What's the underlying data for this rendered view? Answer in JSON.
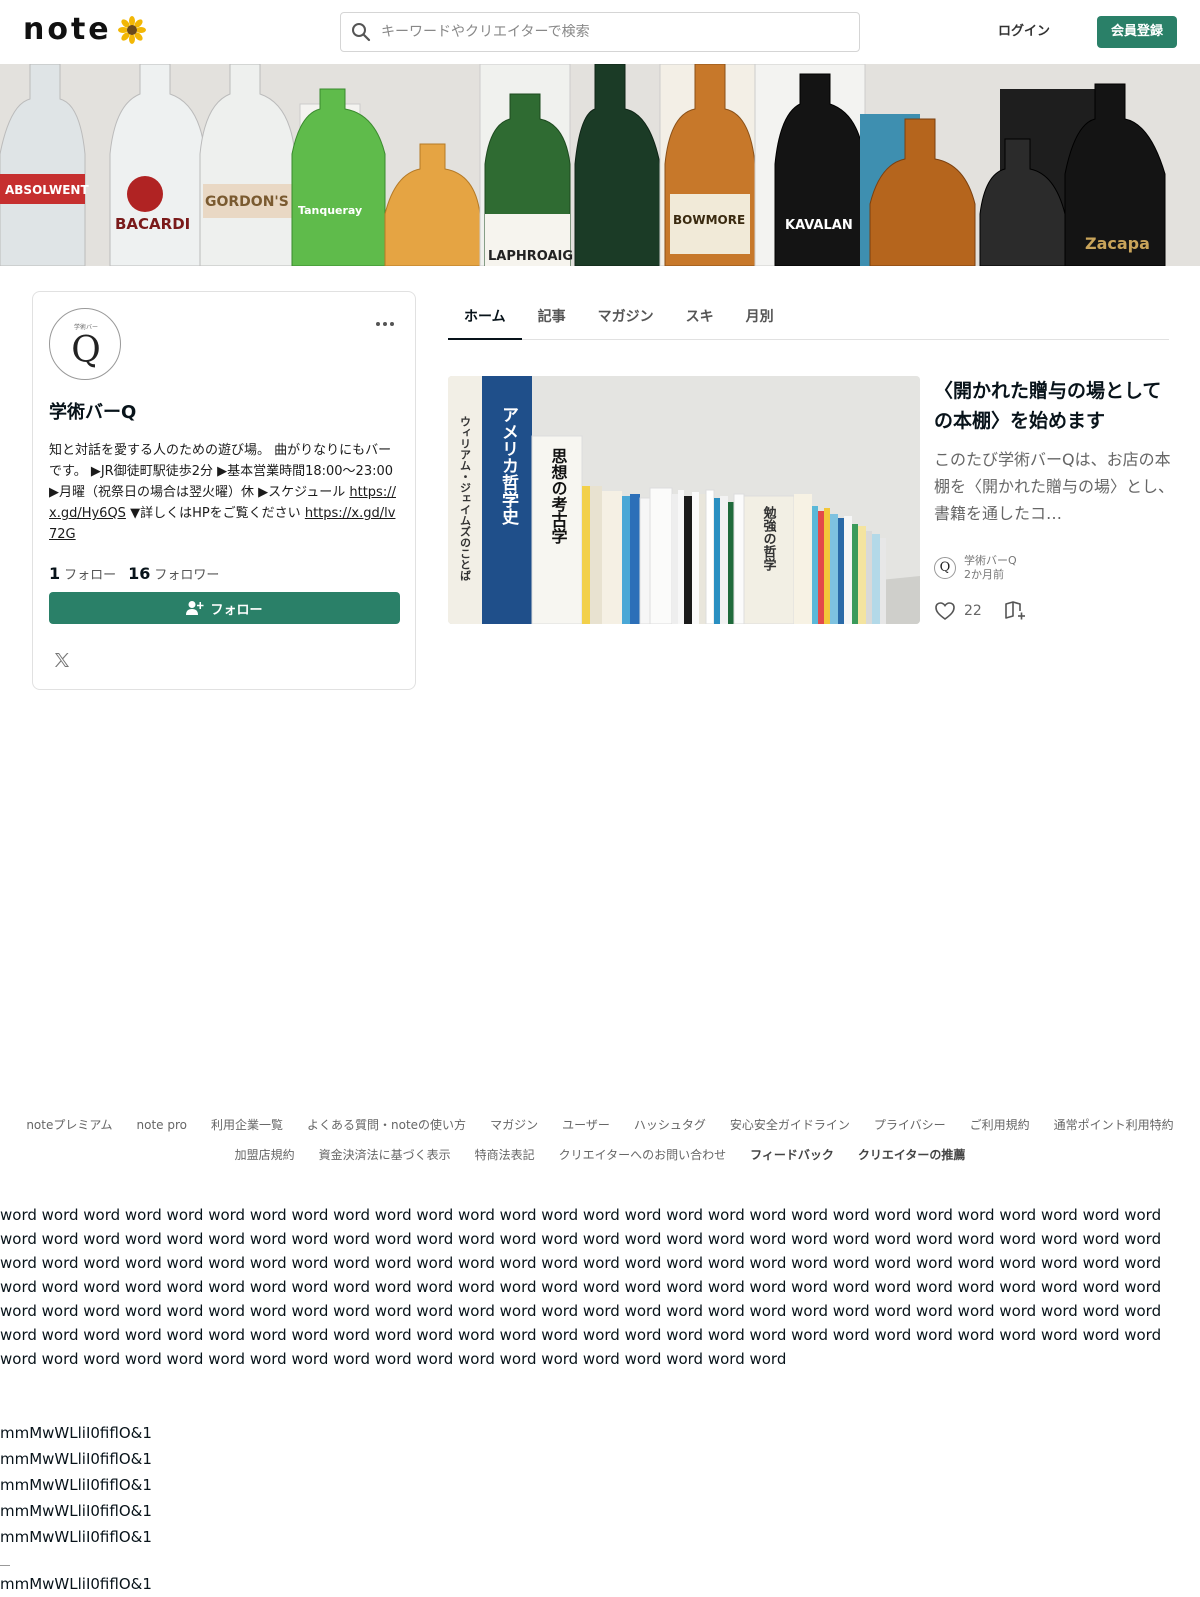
{
  "header": {
    "logo_text": "note",
    "search_placeholder": "キーワードやクリエイターで検索",
    "login_label": "ログイン",
    "signup_label": "会員登録"
  },
  "profile": {
    "avatar_small_text": "学術バー",
    "avatar_letter": "Q",
    "name": "学術バーQ",
    "bio_text": "知と対話を愛する人のための遊び場。 曲がりなりにもバーです。 ▶JR御徒町駅徒歩2分 ▶基本営業時間18:00～23:00 ▶月曜（祝祭日の場合は翌火曜）休 ▶スケジュール ",
    "bio_link1": "https://x.gd/Hy6QS",
    "bio_mid": " ▼詳しくはHPをご覧ください ",
    "bio_link2": "https://x.gd/lv72G",
    "following_count": "1",
    "following_label": "フォロー",
    "followers_count": "16",
    "followers_label": "フォロワー",
    "follow_button": "フォロー"
  },
  "tabs": [
    {
      "label": "ホーム",
      "active": true
    },
    {
      "label": "記事"
    },
    {
      "label": "マガジン"
    },
    {
      "label": "スキ"
    },
    {
      "label": "月別"
    }
  ],
  "article": {
    "title": "〈開かれた贈与の場としての本棚〉を始めます",
    "excerpt": "このたび学術バーQは、お店の本棚を〈開かれた贈与の場〉とし、書籍を通したコ…",
    "author": "学術バーQ",
    "time": "2か月前",
    "likes": "22",
    "thumb_spine1": "アメリカ哲学史",
    "thumb_spine2": "思想の考古学",
    "thumb_spine3": "ウィリアム・ジェイムズのことば",
    "thumb_spine4": "勉強の哲学"
  },
  "banner": {
    "bottle_labels": [
      "ABSOLWENT",
      "BACARDI",
      "GORDON'S",
      "Tanqueray",
      "LAPHROAIG",
      "BOWMORE",
      "KAVALAN",
      "Zacapa"
    ]
  },
  "footer": {
    "row1": [
      "noteプレミアム",
      "note pro",
      "利用企業一覧",
      "よくある質問・noteの使い方",
      "マガジン",
      "ユーザー",
      "ハッシュタグ",
      "安心安全ガイドライン",
      "プライバシー",
      "ご利用規約",
      "通常ポイント利用特約"
    ],
    "row2": [
      "加盟店規約",
      "資金決済法に基づく表示",
      "特商法表記",
      "クリエイターへのお問い合わせ"
    ],
    "row2_strong": [
      "フィードバック",
      "クリエイターの推薦"
    ]
  },
  "filler": {
    "text": "word word word word word word word word word word word word word word word word word word word word word word word word word word word word word word word word word word word word word word word word word word word word word word word word word word word word word word word word word word word word word word word word word word word word word word word word word word word word word word word word word word word word word word word word word word word word word word word word word word word word word word word word word word word word word word word word word word word word word word word word word word word word word word word word word word word word word word word word word word word word word word word word word word word word word word word word word word word word word word word word word word word word word word word word word word word word word word word word word word word word word word word word word word word",
    "sample": "mmMwWLliI0fiflO&1"
  },
  "colors": {
    "accent": "#2a8068"
  }
}
